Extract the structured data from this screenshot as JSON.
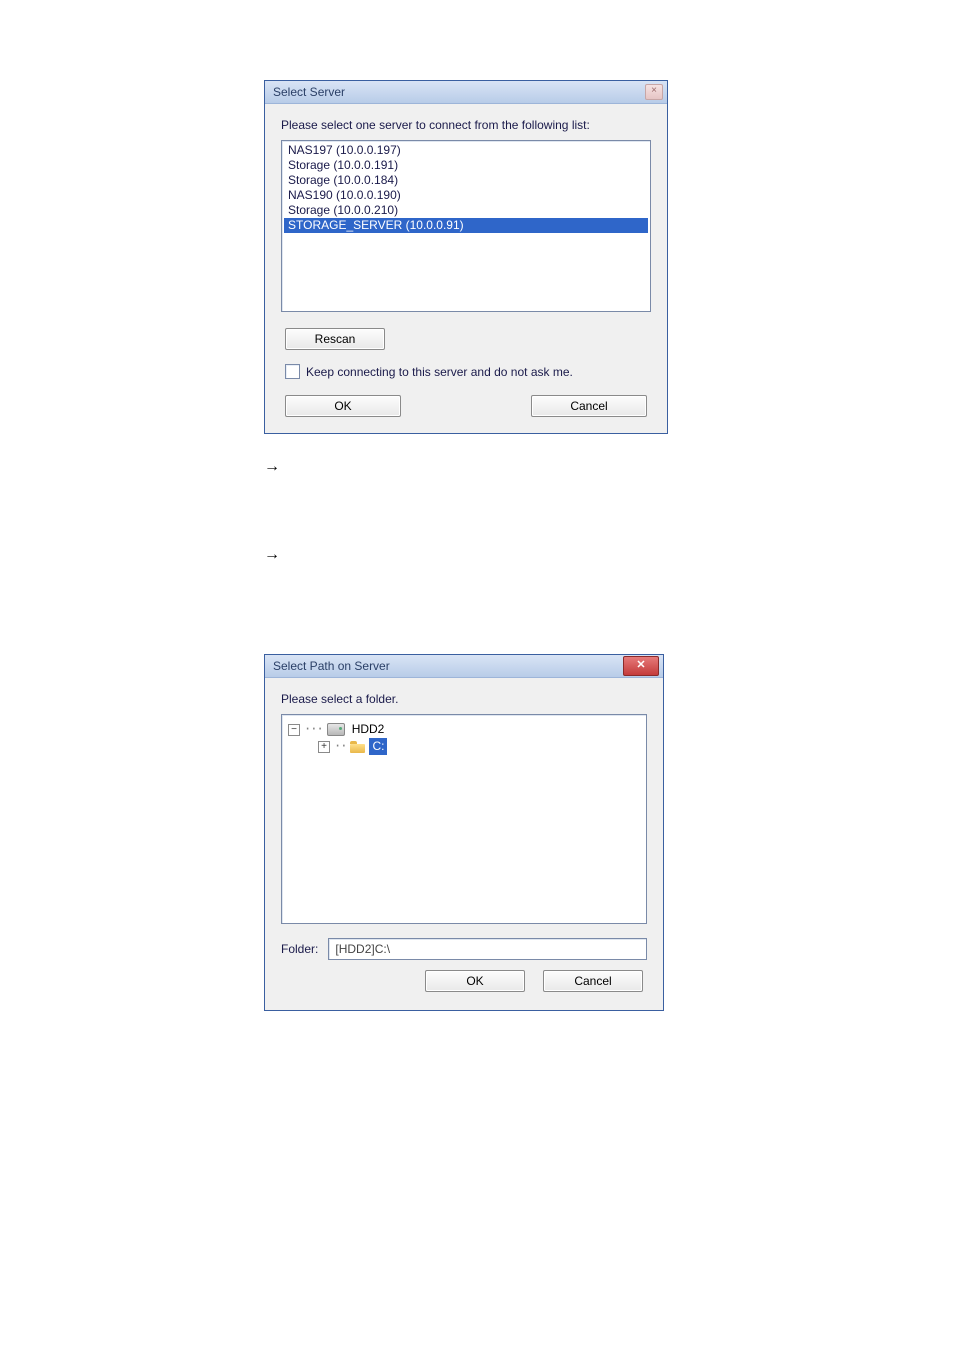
{
  "dialog1": {
    "title": "Select Server",
    "instruction": "Please select one server to connect from the following list:",
    "servers": [
      {
        "label": "NAS197 (10.0.0.197)",
        "selected": false
      },
      {
        "label": "Storage (10.0.0.191)",
        "selected": false
      },
      {
        "label": "Storage (10.0.0.184)",
        "selected": false
      },
      {
        "label": "NAS190 (10.0.0.190)",
        "selected": false
      },
      {
        "label": "Storage (10.0.0.210)",
        "selected": false
      },
      {
        "label": "STORAGE_SERVER (10.0.0.91)",
        "selected": true
      }
    ],
    "rescan": "Rescan",
    "keep_label": "Keep connecting to this server and do not ask me.",
    "keep_checked": false,
    "ok": "OK",
    "cancel": "Cancel"
  },
  "arrow1": "→",
  "arrow2": "→",
  "dialog2": {
    "title": "Select Path on Server",
    "instruction": "Please select a folder.",
    "tree": {
      "root_label": "HDD2",
      "root_expanded": true,
      "child_label": "C:",
      "child_selected": true,
      "child_expanded": false
    },
    "folder_label": "Folder:",
    "folder_value": "[HDD2]C:\\",
    "ok": "OK",
    "cancel": "Cancel"
  }
}
